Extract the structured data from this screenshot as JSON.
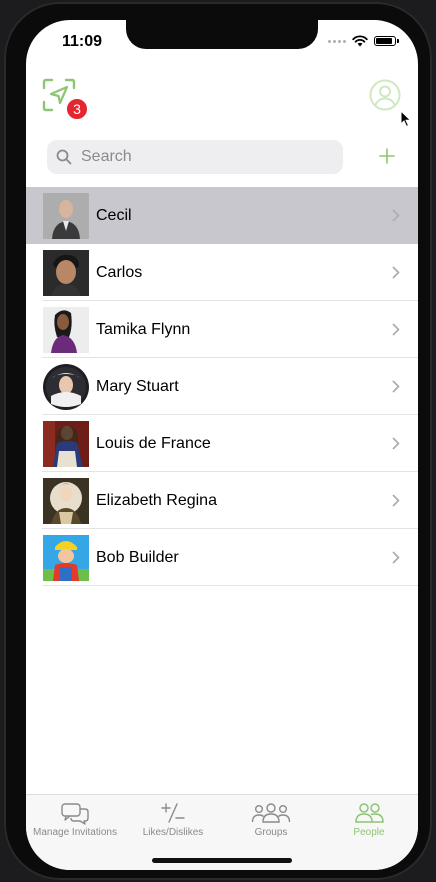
{
  "status": {
    "time": "11:09"
  },
  "header": {
    "notification_count": "3"
  },
  "search": {
    "placeholder": "Search"
  },
  "contacts": [
    {
      "name": "Cecil",
      "selected": true
    },
    {
      "name": "Carlos"
    },
    {
      "name": "Tamika Flynn"
    },
    {
      "name": "Mary Stuart"
    },
    {
      "name": "Louis de France"
    },
    {
      "name": "Elizabeth Regina"
    },
    {
      "name": "Bob Builder"
    }
  ],
  "tabs": [
    {
      "label": "Manage Invitations",
      "icon": "chat-bubbles-icon"
    },
    {
      "label": "Likes/Dislikes",
      "icon": "plus-minus-icon"
    },
    {
      "label": "Groups",
      "icon": "groups-icon"
    },
    {
      "label": "People",
      "icon": "people-icon",
      "active": true
    }
  ],
  "colors": {
    "accent": "#8dc572",
    "badge": "#e5262f",
    "selected_row": "#c8c7cd"
  }
}
